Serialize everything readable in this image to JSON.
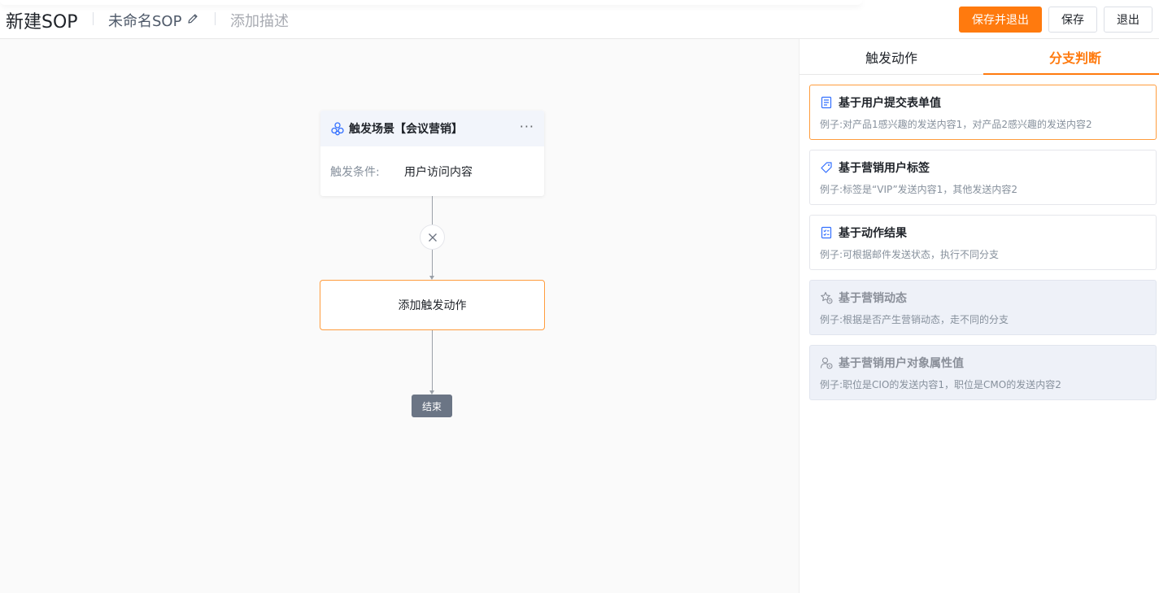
{
  "header": {
    "title": "新建SOP",
    "sop_name": "未命名SOP",
    "add_description": "添加描述",
    "buttons": {
      "save_and_exit": "保存并退出",
      "save": "保存",
      "exit": "退出"
    }
  },
  "canvas": {
    "trigger_node": {
      "title": "触发场景【会议营销】",
      "condition_label": "触发条件:",
      "condition_value": "用户访问内容"
    },
    "add_action_label": "添加触发动作",
    "end_label": "结束"
  },
  "panel": {
    "tabs": [
      {
        "label": "触发动作",
        "active": false
      },
      {
        "label": "分支判断",
        "active": true
      }
    ],
    "options": [
      {
        "icon": "form-icon",
        "title": "基于用户提交表单值",
        "desc": "例子:对产品1感兴趣的发送内容1，对产品2感兴趣的发送内容2",
        "state": "selected"
      },
      {
        "icon": "tag-icon",
        "title": "基于营销用户标签",
        "desc": "例子:标签是“VIP”发送内容1，其他发送内容2",
        "state": "normal"
      },
      {
        "icon": "checklist-icon",
        "title": "基于动作结果",
        "desc": "例子:可根据邮件发送状态，执行不同分支",
        "state": "normal"
      },
      {
        "icon": "star-clock-icon",
        "title": "基于营销动态",
        "desc": "例子:根据是否产生营销动态，走不同的分支",
        "state": "disabled"
      },
      {
        "icon": "user-settings-icon",
        "title": "基于营销用户对象属性值",
        "desc": "例子:职位是CIO的发送内容1，职位是CMO的发送内容2",
        "state": "disabled"
      }
    ]
  },
  "colors": {
    "accent": "#ff7a0e",
    "end_node": "#6b7585",
    "icon_blue": "#3370ff"
  }
}
